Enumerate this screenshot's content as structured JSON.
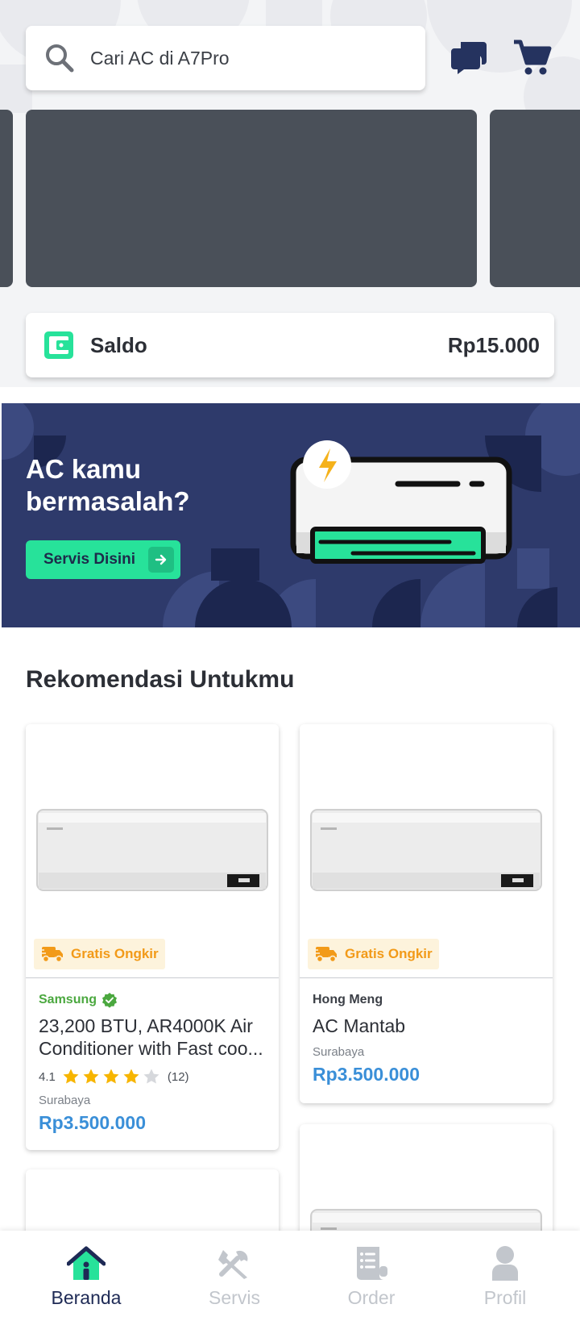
{
  "search": {
    "placeholder": "Cari AC di A7Pro"
  },
  "saldo": {
    "label": "Saldo",
    "value": "Rp15.000"
  },
  "promo": {
    "title": "AC kamu bermasalah?",
    "cta_label": "Servis Disini"
  },
  "recommendations": {
    "title": "Rekomendasi Untukmu",
    "products": [
      {
        "badge": "Gratis Ongkir",
        "brand": "Samsung",
        "verified": true,
        "name": "23,200 BTU, AR4000K Air Conditioner with Fast coo...",
        "rating": "4.1",
        "stars": 4,
        "reviews": "(12)",
        "location": "Surabaya",
        "price": "Rp3.500.000"
      },
      {
        "badge": "Gratis Ongkir",
        "brand": "Hong Meng",
        "verified": false,
        "name": "AC Mantab",
        "location": "Surabaya",
        "price": "Rp3.500.000"
      }
    ]
  },
  "nav": {
    "items": [
      {
        "label": "Beranda",
        "icon": "home-icon",
        "active": true
      },
      {
        "label": "Servis",
        "icon": "tools-icon",
        "active": false
      },
      {
        "label": "Order",
        "icon": "order-list-icon",
        "active": false
      },
      {
        "label": "Profil",
        "icon": "profile-icon",
        "active": false
      }
    ]
  },
  "colors": {
    "accent": "#27e29a",
    "navy": "#2e3a6b",
    "price": "#3a8fd8",
    "badge_text": "#f29a18",
    "verified": "#4ba83f"
  }
}
